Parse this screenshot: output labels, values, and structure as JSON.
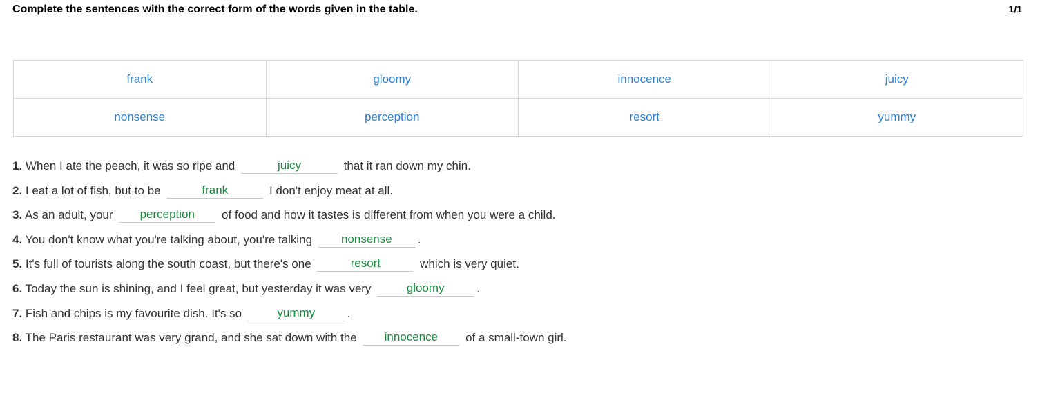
{
  "header": {
    "instructions": "Complete the sentences with the correct form of the words given in the table.",
    "page_indicator": "1/1"
  },
  "word_table": {
    "rows": [
      [
        "frank",
        "gloomy",
        "innocence",
        "juicy"
      ],
      [
        "nonsense",
        "perception",
        "resort",
        "yummy"
      ]
    ]
  },
  "sentences": [
    {
      "number": "1.",
      "before": " When I ate the peach, it was so ripe and ",
      "answer": "juicy",
      "after": " that it ran down my chin."
    },
    {
      "number": "2.",
      "before": " I eat a lot of fish, but to be ",
      "answer": "frank",
      "after": " I don't enjoy meat at all."
    },
    {
      "number": "3.",
      "before": " As an adult, your ",
      "answer": "perception",
      "after": " of food and how it tastes is different from when you were a child."
    },
    {
      "number": "4.",
      "before": " You don't know what you're talking about, you're talking ",
      "answer": "nonsense",
      "after": "."
    },
    {
      "number": "5.",
      "before": " It's full of tourists along the south coast, but there's one ",
      "answer": "resort",
      "after": " which is very quiet."
    },
    {
      "number": "6.",
      "before": " Today the sun is shining, and I feel great, but yesterday it was very ",
      "answer": "gloomy",
      "after": "."
    },
    {
      "number": "7.",
      "before": " Fish and chips is my favourite dish. It's so ",
      "answer": "yummy",
      "after": "."
    },
    {
      "number": "8.",
      "before": " The Paris restaurant was very grand, and she sat down with the ",
      "answer": "innocence",
      "after": " of a small-town girl."
    }
  ],
  "colors": {
    "word_blue": "#2f80d1",
    "answer_green": "#1b8a3e",
    "text": "#333333"
  }
}
